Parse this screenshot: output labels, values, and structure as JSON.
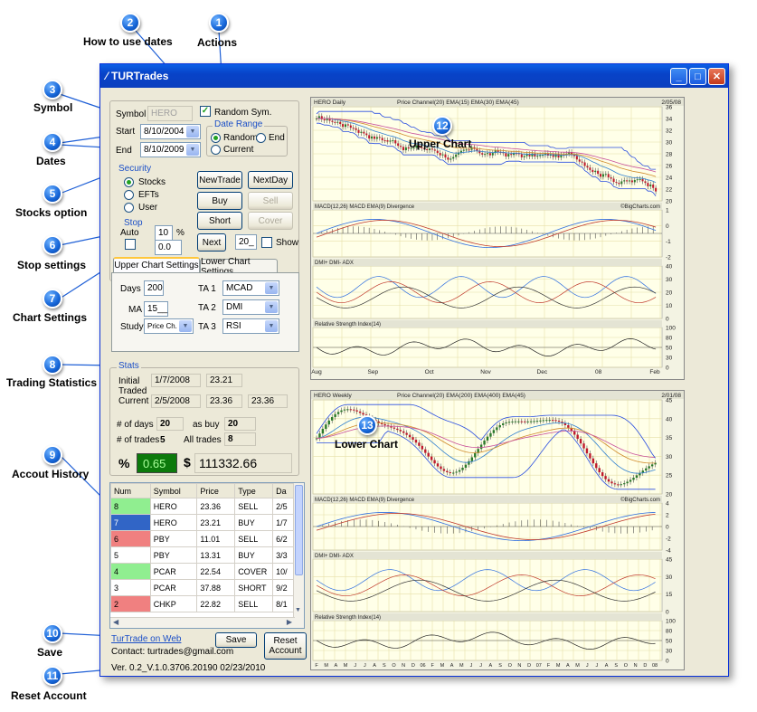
{
  "window": {
    "title": "TURTrades"
  },
  "callouts": [
    {
      "num": "1",
      "label": "Actions"
    },
    {
      "num": "2",
      "label": "How to use dates"
    },
    {
      "num": "3",
      "label": "Symbol"
    },
    {
      "num": "4",
      "label": "Dates"
    },
    {
      "num": "5",
      "label": "Stocks option"
    },
    {
      "num": "6",
      "label": "Stop settings"
    },
    {
      "num": "7",
      "label": "Chart Settings"
    },
    {
      "num": "8",
      "label": "Trading Statistics"
    },
    {
      "num": "9",
      "label": "Accout History"
    },
    {
      "num": "10",
      "label": "Save"
    },
    {
      "num": "11",
      "label": "Reset Account"
    },
    {
      "num": "12",
      "label": "Upper Chart"
    },
    {
      "num": "13",
      "label": "Lower Chart"
    }
  ],
  "symbol": {
    "label": "Symbol",
    "value": "HERO",
    "random_label": "Random Sym."
  },
  "date_range": {
    "title": "Date Range",
    "start_label": "Start",
    "start_value": "8/10/2004",
    "end_label": "End",
    "end_value": "8/10/2009",
    "random_label": "Random",
    "end_opt_label": "End",
    "current_label": "Current"
  },
  "security": {
    "title": "Security",
    "stocks": "Stocks",
    "etfs": "EFTs",
    "user": "User"
  },
  "stop": {
    "title": "Stop",
    "auto_label": "Auto",
    "pct_value": "10",
    "pct_sign": "%",
    "stop_value": "0.0"
  },
  "actions": {
    "new_trade": "NewTrade",
    "next_day": "NextDay",
    "buy": "Buy",
    "sell": "Sell",
    "short": "Short",
    "cover": "Cover",
    "next": "Next",
    "days_value": "20_",
    "show_label": "Show"
  },
  "chart_settings": {
    "tab_upper": "Upper Chart Settings",
    "tab_lower": "Lower Chart Settings",
    "days_label": "Days",
    "days_value": "200",
    "ma_label": "MA",
    "ma_value": "15__",
    "study_label": "Study",
    "study_value": "Price Ch.",
    "ta1_label": "TA 1",
    "ta1_value": "MCAD",
    "ta2_label": "TA 2",
    "ta2_value": "DMI",
    "ta3_label": "TA 3",
    "ta3_value": "RSI"
  },
  "stats": {
    "title": "Stats",
    "initial_label": "Initial",
    "initial_date": "1/7/2008",
    "initial_price": "23.21",
    "traded_label": "Traded",
    "current_label": "Current",
    "current_date": "2/5/2008",
    "current_price": "23.36",
    "current_price2": "23.36",
    "days_label": "# of days",
    "days_value": "20",
    "as_buy_label": "as buy",
    "as_buy_value": "20",
    "trades_label": "# of trades",
    "trades_value": "5",
    "all_trades_label": "All trades",
    "all_trades_value": "8",
    "pct_sign": "%",
    "pct_value": "0.65",
    "dollar_sign": "$",
    "dollar_value": "111332.66"
  },
  "history": {
    "headers": [
      "Num",
      "Symbol",
      "Price",
      "Type",
      "Da"
    ],
    "rows": [
      {
        "num": "8",
        "symbol": "HERO",
        "price": "23.36",
        "type": "SELL",
        "date": "2/5",
        "color": "#90ee90"
      },
      {
        "num": "7",
        "symbol": "HERO",
        "price": "23.21",
        "type": "BUY",
        "date": "1/7",
        "color": "#3165c6"
      },
      {
        "num": "6",
        "symbol": "PBY",
        "price": "11.01",
        "type": "SELL",
        "date": "6/2",
        "color": "#f08080"
      },
      {
        "num": "5",
        "symbol": "PBY",
        "price": "13.31",
        "type": "BUY",
        "date": "3/3",
        "color": "#ffffff"
      },
      {
        "num": "4",
        "symbol": "PCAR",
        "price": "22.54",
        "type": "COVER",
        "date": "10/",
        "color": "#90ee90"
      },
      {
        "num": "3",
        "symbol": "PCAR",
        "price": "37.88",
        "type": "SHORT",
        "date": "9/2",
        "color": "#ffffff"
      },
      {
        "num": "2",
        "symbol": "CHKP",
        "price": "22.82",
        "type": "SELL",
        "date": "8/1",
        "color": "#f08080"
      }
    ]
  },
  "footer": {
    "web_link": "TurTrade on Web",
    "save": "Save",
    "reset_line1": "Reset",
    "reset_line2": "Account",
    "contact": "Contact:  turtrades@gmail.com",
    "version": "Ver.  0.2_V.1.0.3706.20190  02/23/2010"
  },
  "upper_chart": {
    "header_left": "HERO Daily",
    "header_legend": "Price Channel(20)  EMA(15)  EMA(30)  EMA(45)",
    "header_date": "2/05/08",
    "y_ticks": [
      "36",
      "34",
      "32",
      "30",
      "28",
      "26",
      "24",
      "22",
      "20"
    ],
    "macd_label": "MACD(12,26)  MACD EMA(9)  Divergence",
    "credit": "©BigCharts.com",
    "macd_ticks": [
      "1",
      "0",
      "-1",
      "-2"
    ],
    "dmi_label": "DMI+  DMI-  ADX",
    "dmi_ticks": [
      "40",
      "30",
      "20",
      "10",
      "0"
    ],
    "rsi_label": "Relative Strength Index(14)",
    "rsi_ticks": [
      "100",
      "80",
      "50",
      "30",
      "0"
    ],
    "x_ticks": [
      "Aug",
      "Sep",
      "Oct",
      "Nov",
      "Dec",
      "08",
      "Feb"
    ]
  },
  "lower_chart": {
    "header_left": "HERO Weekly",
    "header_legend": "Price Channel(20)  EMA(200)  EMA(400)  EMA(45)",
    "header_date": "2/01/08",
    "y_ticks": [
      "45",
      "40",
      "35",
      "30",
      "25",
      "20"
    ],
    "macd_label": "MACD(12,26)  MACD EMA(9)  Divergence",
    "credit": "©BigCharts.com",
    "macd_ticks": [
      "4",
      "2",
      "0",
      "-2",
      "-4"
    ],
    "dmi_label": "DMI+  DMI-  ADX",
    "dmi_ticks": [
      "45",
      "30",
      "15",
      "0"
    ],
    "rsi_label": "Relative Strength Index(14)",
    "rsi_ticks": [
      "100",
      "80",
      "50",
      "30",
      "0"
    ],
    "x_ticks": [
      "F",
      "M",
      "A",
      "M",
      "J",
      "J",
      "A",
      "S",
      "O",
      "N",
      "D",
      "06",
      "F",
      "M",
      "A",
      "M",
      "J",
      "J",
      "A",
      "S",
      "O",
      "N",
      "D",
      "07",
      "F",
      "M",
      "A",
      "M",
      "J",
      "J",
      "A",
      "S",
      "O",
      "N",
      "D",
      "08"
    ]
  },
  "colors": {
    "accent": "#1b4fc7",
    "pct_box": "#0c7a0c",
    "callout": "#1565d8"
  }
}
